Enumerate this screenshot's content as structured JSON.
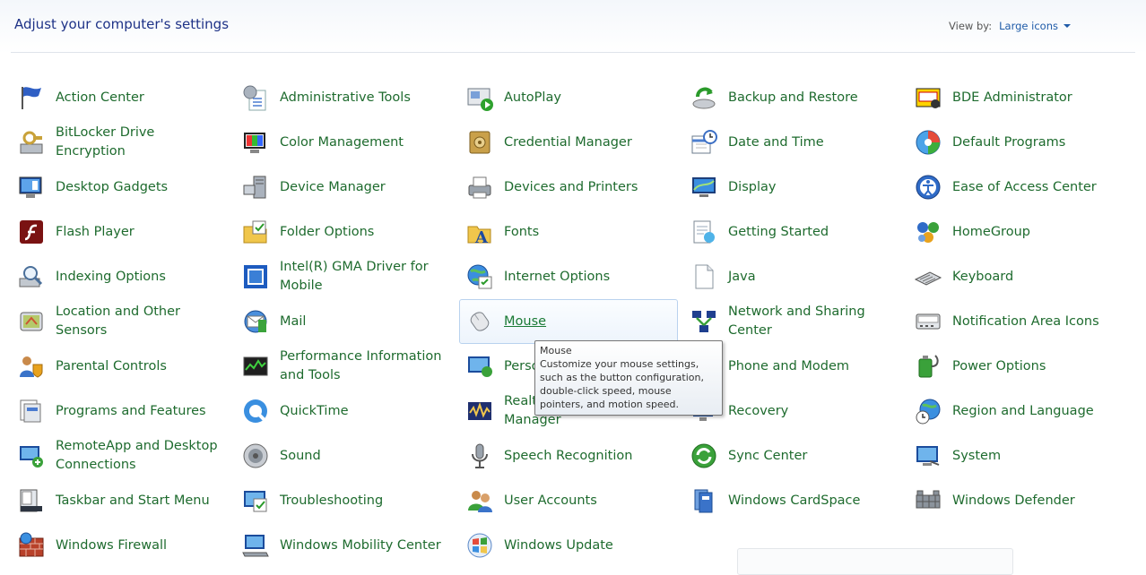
{
  "header": {
    "title": "Adjust your computer's settings",
    "view_by_label": "View by:",
    "view_by_value": "Large icons"
  },
  "items": [
    {
      "label": "Action Center",
      "icon": "flag-icon"
    },
    {
      "label": "Administrative Tools",
      "icon": "admin-tools-icon"
    },
    {
      "label": "AutoPlay",
      "icon": "autoplay-icon"
    },
    {
      "label": "Backup and Restore",
      "icon": "backup-icon"
    },
    {
      "label": "BDE Administrator",
      "icon": "bde-icon"
    },
    {
      "label": "BitLocker Drive Encryption",
      "icon": "bitlocker-icon"
    },
    {
      "label": "Color Management",
      "icon": "color-icon"
    },
    {
      "label": "Credential Manager",
      "icon": "vault-icon"
    },
    {
      "label": "Date and Time",
      "icon": "calendar-clock-icon"
    },
    {
      "label": "Default Programs",
      "icon": "default-programs-icon"
    },
    {
      "label": "Desktop Gadgets",
      "icon": "gadgets-icon"
    },
    {
      "label": "Device Manager",
      "icon": "device-manager-icon"
    },
    {
      "label": "Devices and Printers",
      "icon": "printer-icon"
    },
    {
      "label": "Display",
      "icon": "display-icon"
    },
    {
      "label": "Ease of Access Center",
      "icon": "ease-access-icon"
    },
    {
      "label": "Flash Player",
      "icon": "flash-icon"
    },
    {
      "label": "Folder Options",
      "icon": "folder-options-icon"
    },
    {
      "label": "Fonts",
      "icon": "fonts-icon"
    },
    {
      "label": "Getting Started",
      "icon": "getting-started-icon"
    },
    {
      "label": "HomeGroup",
      "icon": "homegroup-icon"
    },
    {
      "label": "Indexing Options",
      "icon": "indexing-icon"
    },
    {
      "label": "Intel(R) GMA Driver for Mobile",
      "icon": "intel-icon"
    },
    {
      "label": "Internet Options",
      "icon": "internet-icon"
    },
    {
      "label": "Java",
      "icon": "java-icon"
    },
    {
      "label": "Keyboard",
      "icon": "keyboard-icon"
    },
    {
      "label": "Location and Other Sensors",
      "icon": "sensors-icon"
    },
    {
      "label": "Mail",
      "icon": "mail-icon"
    },
    {
      "label": "Mouse",
      "icon": "mouse-icon"
    },
    {
      "label": "Network and Sharing Center",
      "icon": "network-icon"
    },
    {
      "label": "Notification Area Icons",
      "icon": "notification-icon"
    },
    {
      "label": "Parental Controls",
      "icon": "parental-icon"
    },
    {
      "label": "Performance Information and Tools",
      "icon": "performance-icon"
    },
    {
      "label": "Personalization",
      "icon": "personalization-icon"
    },
    {
      "label": "Phone and Modem",
      "icon": "phone-icon"
    },
    {
      "label": "Power Options",
      "icon": "power-icon"
    },
    {
      "label": "Programs and Features",
      "icon": "programs-icon"
    },
    {
      "label": "QuickTime",
      "icon": "quicktime-icon"
    },
    {
      "label": "Realtek HD Audio Manager",
      "icon": "realtek-icon"
    },
    {
      "label": "Recovery",
      "icon": "recovery-icon"
    },
    {
      "label": "Region and Language",
      "icon": "region-icon"
    },
    {
      "label": "RemoteApp and Desktop Connections",
      "icon": "remoteapp-icon"
    },
    {
      "label": "Sound",
      "icon": "speaker-icon"
    },
    {
      "label": "Speech Recognition",
      "icon": "microphone-icon"
    },
    {
      "label": "Sync Center",
      "icon": "sync-icon"
    },
    {
      "label": "System",
      "icon": "system-icon"
    },
    {
      "label": "Taskbar and Start Menu",
      "icon": "taskbar-icon"
    },
    {
      "label": "Troubleshooting",
      "icon": "troubleshooting-icon"
    },
    {
      "label": "User Accounts",
      "icon": "users-icon"
    },
    {
      "label": "Windows CardSpace",
      "icon": "cardspace-icon"
    },
    {
      "label": "Windows Defender",
      "icon": "defender-icon"
    },
    {
      "label": "Windows Firewall",
      "icon": "firewall-icon"
    },
    {
      "label": "Windows Mobility Center",
      "icon": "mobility-icon"
    },
    {
      "label": "Windows Update",
      "icon": "update-icon"
    }
  ],
  "hovered_index": 27,
  "tooltip": {
    "title": "Mouse",
    "description": "Customize your mouse settings, such as the button configuration, double-click speed, mouse pointers, and motion speed."
  },
  "colors": {
    "link": "#1e6b2e",
    "title": "#1e3287",
    "hover_border": "#b9d2ee"
  }
}
